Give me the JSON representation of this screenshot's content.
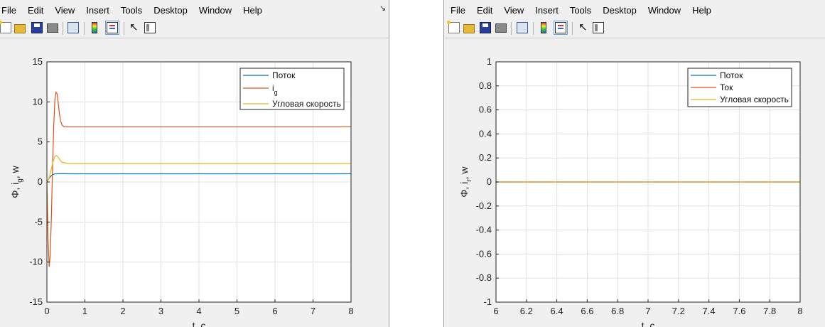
{
  "menu": [
    "File",
    "Edit",
    "View",
    "Insert",
    "Tools",
    "Desktop",
    "Window",
    "Help"
  ],
  "dock_arrow": "↘",
  "toolbar_icons": [
    "new-figure-icon",
    "open-file-icon",
    "save-icon",
    "print-icon",
    "link-plot-icon",
    "insert-colorbar-icon",
    "insert-legend-icon",
    "edit-plot-arrow-icon",
    "show-plot-tools-icon"
  ],
  "colors": {
    "series1": "#0072BD",
    "series2": "#D95319",
    "series3": "#EDB120",
    "grid": "#e1e1e1",
    "axes": "#262626"
  },
  "chart_data": [
    {
      "type": "line",
      "xlim": [
        0,
        8
      ],
      "ylim": [
        -15,
        15
      ],
      "xticks": [
        0,
        1,
        2,
        3,
        4,
        5,
        6,
        7,
        8
      ],
      "yticks": [
        -15,
        -10,
        -5,
        0,
        5,
        10,
        15
      ],
      "xlabel": "t, c",
      "ylabel": {
        "pre": "Φ, i",
        "sub": "g",
        "post": ", w"
      },
      "grid": true,
      "legend_position": "top-right",
      "series": [
        {
          "name": "Поток",
          "x": [
            0,
            0.05,
            0.1,
            0.15,
            0.2,
            0.3,
            0.4,
            0.6,
            0.8,
            1,
            8
          ],
          "y": [
            0,
            0.4,
            0.7,
            0.9,
            1.0,
            1.03,
            1.03,
            1.02,
            1.02,
            1.02,
            1.02
          ]
        },
        {
          "name": "i",
          "name_sub": "g",
          "x": [
            0,
            0.03,
            0.06,
            0.09,
            0.12,
            0.15,
            0.18,
            0.21,
            0.24,
            0.27,
            0.3,
            0.33,
            0.36,
            0.4,
            0.45,
            0.5,
            0.55,
            0.6,
            0.7,
            0.8,
            8
          ],
          "y": [
            0,
            -7,
            -10.6,
            -9,
            -4,
            2,
            7,
            10.2,
            11.2,
            11,
            9.8,
            8.5,
            7.6,
            7.1,
            6.9,
            6.9,
            6.9,
            6.9,
            6.9,
            6.9,
            6.9
          ]
        },
        {
          "name": "Угловая скорость",
          "x": [
            0,
            0.05,
            0.1,
            0.15,
            0.2,
            0.25,
            0.3,
            0.35,
            0.4,
            0.5,
            0.6,
            0.8,
            8
          ],
          "y": [
            0,
            0.4,
            1.3,
            2.3,
            3.1,
            3.3,
            3.1,
            2.7,
            2.45,
            2.35,
            2.3,
            2.3,
            2.3
          ]
        }
      ]
    },
    {
      "type": "line",
      "xlim": [
        6,
        8
      ],
      "ylim": [
        -1,
        1
      ],
      "xticks": [
        6,
        6.2,
        6.4,
        6.6,
        6.8,
        7,
        7.2,
        7.4,
        7.6,
        7.8,
        8
      ],
      "yticks": [
        -1,
        -0.8,
        -0.6,
        -0.4,
        -0.2,
        0,
        0.2,
        0.4,
        0.6,
        0.8,
        1
      ],
      "xlabel": "t, c",
      "ylabel": {
        "pre": "Φ, i",
        "sub": "r",
        "post": ", w"
      },
      "grid": true,
      "legend_position": "top-right",
      "series": [
        {
          "name": "Поток",
          "x": [
            6,
            8
          ],
          "y": [
            0,
            0
          ]
        },
        {
          "name": "Ток",
          "x": [
            6,
            8
          ],
          "y": [
            0,
            0
          ]
        },
        {
          "name": "Угловая скорость",
          "x": [
            6,
            8
          ],
          "y": [
            0,
            0
          ]
        }
      ]
    }
  ]
}
